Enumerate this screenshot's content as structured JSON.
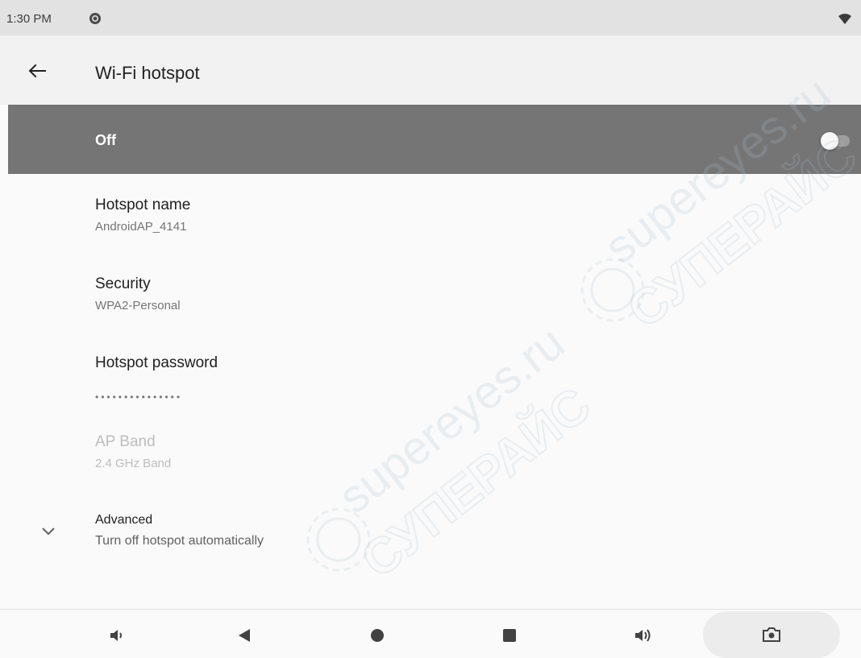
{
  "status_bar": {
    "time": "1:30 PM",
    "left_icon": "app-notification-icon",
    "right_icon": "wifi-signal-icon"
  },
  "app_bar": {
    "back_icon": "arrow-back-icon",
    "title": "Wi-Fi hotspot"
  },
  "master_switch": {
    "label": "Off",
    "state": "off"
  },
  "preferences": [
    {
      "title": "Hotspot name",
      "summary": "AndroidAP_4141",
      "enabled": true
    },
    {
      "title": "Security",
      "summary": "WPA2-Personal",
      "enabled": true
    },
    {
      "title": "Hotspot password",
      "summary": "•••••••••••••••",
      "enabled": true
    },
    {
      "title": "AP Band",
      "summary": "2.4 GHz Band",
      "enabled": false
    }
  ],
  "advanced": {
    "icon": "chevron-down-icon",
    "title": "Advanced",
    "summary": "Turn off hotspot automatically"
  },
  "nav_bar": {
    "buttons": [
      "volume-down-icon",
      "back-triangle-icon",
      "home-circle-icon",
      "recents-square-icon",
      "volume-up-icon",
      "camera-screenshot-icon"
    ]
  },
  "watermark": {
    "lines": [
      "supereyes.ru",
      "СУПЕРАЙС"
    ]
  },
  "colors": {
    "status_bar": "#e2e2e2",
    "app_bar": "#f2f2f2",
    "master_bar": "#757575",
    "background": "#fafafa"
  }
}
